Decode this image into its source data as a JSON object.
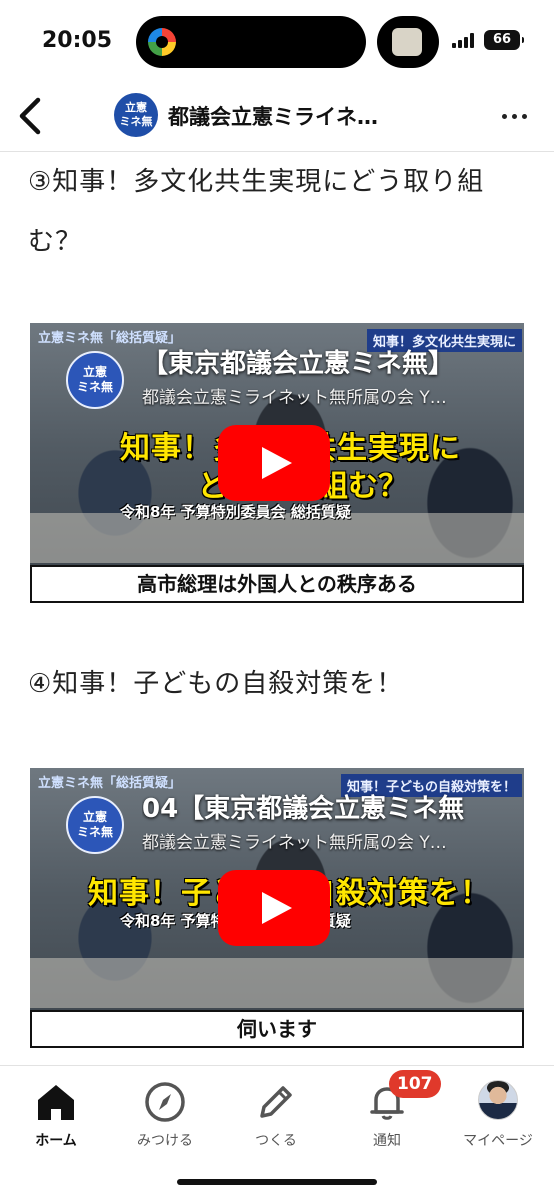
{
  "status_bar": {
    "time": "20:05",
    "battery": "66"
  },
  "header": {
    "badge_line1": "立憲",
    "badge_line2": "ミネ無",
    "title": "都議会立憲ミライネ…"
  },
  "post": {
    "section3_heading": "③知事！多文化共生実現にどう取り組む？",
    "video1": {
      "top_banner": "立憲ミネ無「総括質疑」",
      "right_banner": "知事！多文化共生実現に",
      "logo_line1": "立憲",
      "logo_line2": "ミネ無",
      "title": "【東京都議会立憲ミネ無】",
      "channel": "都議会立憲ミライネット無所属の会 Y…",
      "overlay_line1": "知事！多文化共生実現に",
      "overlay_line2": "どう取り組む？",
      "subline": "令和8年 予算特別委員会 総括質疑",
      "caption": "高市総理は外国人との秩序ある"
    },
    "section4_heading": "④知事！子どもの自殺対策を！",
    "video2": {
      "top_banner": "立憲ミネ無「総括質疑」",
      "right_banner": "知事！子どもの自殺対策を！",
      "logo_line1": "立憲",
      "logo_line2": "ミネ無",
      "title": "04【東京都議会立憲ミネ無",
      "channel": "都議会立憲ミライネット無所属の会 Y…",
      "overlay_line1": "知事！子どもの自殺対策を！",
      "subline": "令和8年 予算特別委員会 総括質疑",
      "caption": "伺います"
    }
  },
  "tabbar": {
    "home": "ホーム",
    "discover": "みつける",
    "create": "つくる",
    "notifications": "通知",
    "notifications_badge": "107",
    "mypage": "マイページ"
  },
  "colors": {
    "accent_blue": "#1f4ea8",
    "badge_red": "#e0392b",
    "play_red": "#ff0000",
    "overlay_yellow": "#ffe600"
  },
  "icons": {
    "back": "chevron-left-icon",
    "more": "more-horizontal-icon",
    "home": "home-icon",
    "discover": "compass-icon",
    "create": "pencil-icon",
    "notifications": "bell-icon",
    "play": "youtube-play-icon"
  }
}
